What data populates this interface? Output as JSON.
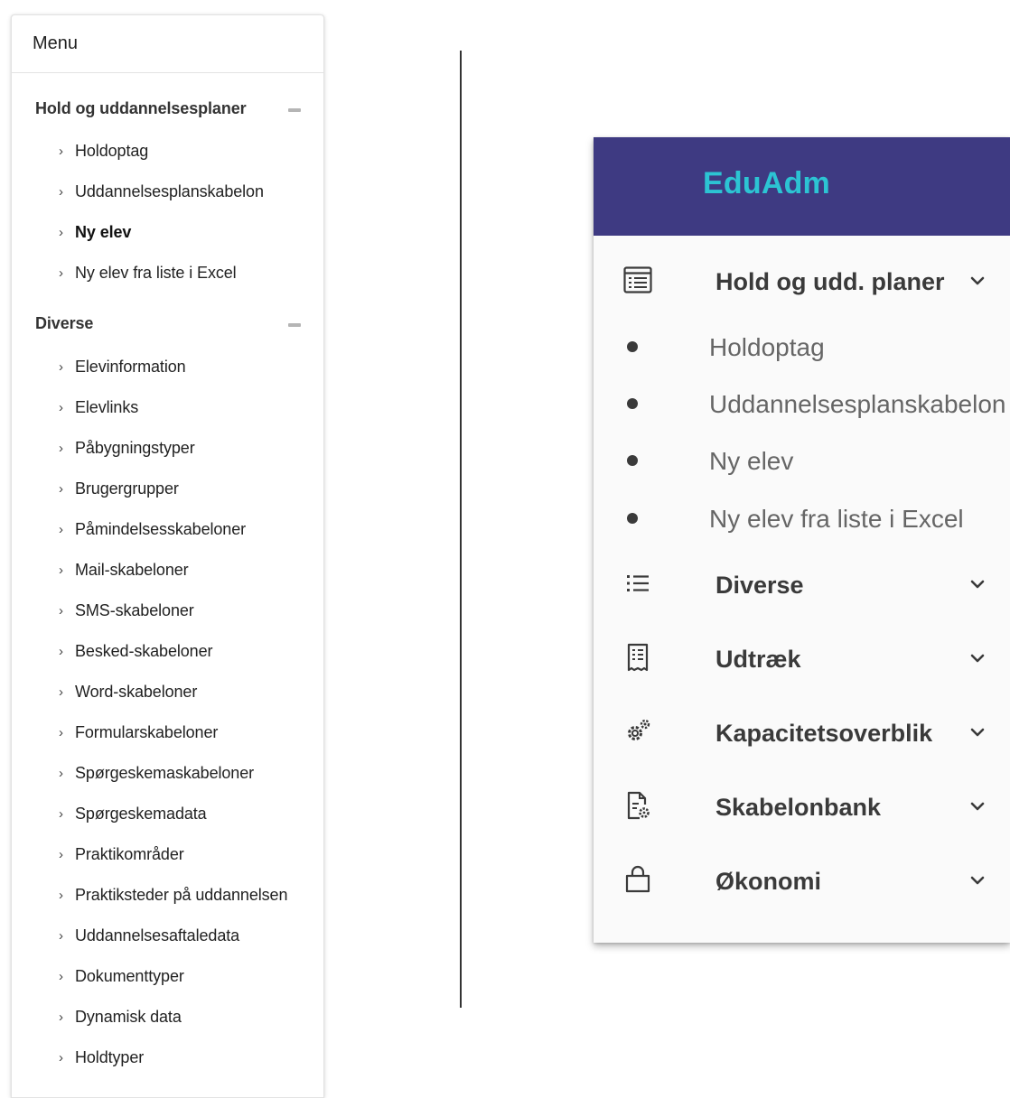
{
  "old_menu": {
    "title": "Menu",
    "sections": [
      {
        "title": "Hold og uddannelsesplaner",
        "items": [
          {
            "label": "Holdoptag"
          },
          {
            "label": "Uddannelsesplanskabelon"
          },
          {
            "label": "Ny elev",
            "active": true
          },
          {
            "label": "Ny elev fra liste i Excel"
          }
        ]
      },
      {
        "title": "Diverse",
        "items": [
          {
            "label": "Elevinformation"
          },
          {
            "label": "Elevlinks"
          },
          {
            "label": "Påbygningstyper"
          },
          {
            "label": "Brugergrupper"
          },
          {
            "label": "Påmindelsesskabeloner"
          },
          {
            "label": "Mail-skabeloner"
          },
          {
            "label": "SMS-skabeloner"
          },
          {
            "label": "Besked-skabeloner"
          },
          {
            "label": "Word-skabeloner"
          },
          {
            "label": "Formularskabeloner"
          },
          {
            "label": "Spørgeskemaskabeloner"
          },
          {
            "label": "Spørgeskemadata"
          },
          {
            "label": "Praktikområder"
          },
          {
            "label": "Praktiksteder på uddannelsen"
          },
          {
            "label": "Uddannelsesaftaledata"
          },
          {
            "label": "Dokumenttyper"
          },
          {
            "label": "Dynamisk data"
          },
          {
            "label": "Holdtyper"
          }
        ]
      }
    ]
  },
  "new_menu": {
    "brand": "EduAdm",
    "colors": {
      "header_bg": "#3e3a82",
      "brand_text": "#2cc4d3",
      "panel_bg": "#fafafa"
    },
    "groups": [
      {
        "label": "Hold og udd. planer",
        "icon": "list-table-icon",
        "expanded": true,
        "items": [
          {
            "label": "Holdoptag"
          },
          {
            "label": "Uddannelsesplanskabelon"
          },
          {
            "label": "Ny elev"
          },
          {
            "label": "Ny elev fra liste i Excel"
          }
        ]
      },
      {
        "label": "Diverse",
        "icon": "bullet-list-icon"
      },
      {
        "label": "Udtræk",
        "icon": "receipt-icon"
      },
      {
        "label": "Kapacitetsoverblik",
        "icon": "gears-icon"
      },
      {
        "label": "Skabelonbank",
        "icon": "document-settings-icon"
      },
      {
        "label": "Økonomi",
        "icon": "shopping-bag-icon"
      }
    ]
  }
}
